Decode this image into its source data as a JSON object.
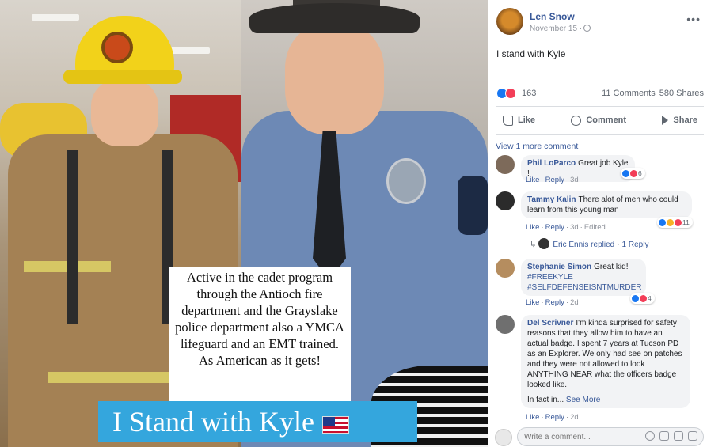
{
  "photo": {
    "caption": "Active in the cadet program through the Antioch fire department and the Grayslake police department also a YMCA lifeguard and an EMT trained. As American as it gets!",
    "banner": "I Stand with Kyle"
  },
  "post": {
    "author": "Len Snow",
    "date": "November 15 ·",
    "text": "I stand with Kyle",
    "reaction_count": "163",
    "comments": "11 Comments",
    "shares": "580 Shares",
    "actions": {
      "like": "Like",
      "comment": "Comment",
      "share": "Share"
    }
  },
  "comments_section": {
    "view_more": "View 1 more comment",
    "comments": [
      {
        "name": "Phil LoParco",
        "text": "Great job Kyle !",
        "react_count": "6",
        "like": "Like",
        "reply": "Reply",
        "time": "3d",
        "extra": ""
      },
      {
        "name": "Tammy Kalin",
        "text": "There alot of men who could learn from this young man",
        "react_count": "11",
        "like": "Like",
        "reply": "Reply",
        "time": "3d",
        "extra": "Edited"
      },
      {
        "name": "Stephanie Simon",
        "text": "Great kid!",
        "tags": [
          "#FREEKYLE",
          "#SELFDEFENSEISNTMURDER"
        ],
        "react_count": "4",
        "like": "Like",
        "reply": "Reply",
        "time": "2d",
        "extra": ""
      },
      {
        "name": "Del Scrivner",
        "text": "I'm kinda surprised for safety reasons that they allow him to have an actual badge. I spent 7 years at Tucson PD as an Explorer. We only had see on patches and they were not allowed to look ANYTHING NEAR what the officers badge looked like.",
        "tail": "In fact in...",
        "see_more": "See More",
        "like": "Like",
        "reply": "Reply",
        "time": "2d",
        "extra": ""
      }
    ],
    "reply_line": {
      "author": "Eric Ennis replied",
      "count": "1 Reply"
    }
  },
  "composer": {
    "placeholder": "Write a comment..."
  },
  "colors": {
    "link": "#385898",
    "like": "#1877f2",
    "love": "#f33e58",
    "banner": "#34a6dd"
  }
}
